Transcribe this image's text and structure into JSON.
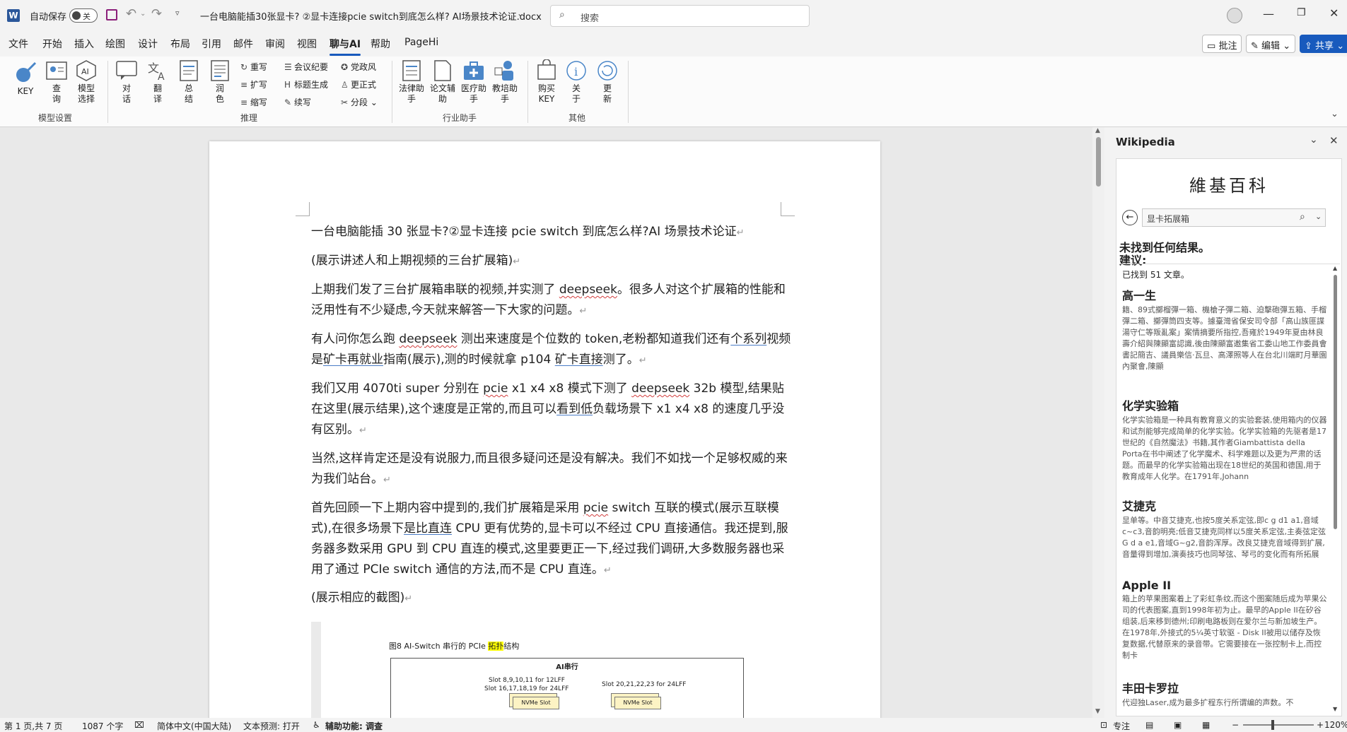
{
  "titlebar": {
    "autosave_label": "自动保存",
    "autosave_state": "关",
    "doc_title": "一台电脑能插30张显卡? ②显卡连接pcie switch到底怎么样? AI场景技术论证.docx",
    "search_placeholder": "搜索"
  },
  "menu": {
    "items": [
      "文件",
      "开始",
      "插入",
      "绘图",
      "设计",
      "布局",
      "引用",
      "邮件",
      "审阅",
      "视图",
      "聊与AI",
      "帮助",
      "PageHi"
    ],
    "active": "聊与AI",
    "comment_btn": "批注",
    "edit_btn": "编辑",
    "share_btn": "共享"
  },
  "ribbon": {
    "model_group": {
      "label": "模型设置",
      "key": "KEY",
      "query": "查询",
      "model": "模型选择"
    },
    "infer_group": {
      "label": "推理",
      "dialog": "对话",
      "translate": "翻译",
      "summary": "总结",
      "polish": "润色",
      "rewrite": "重写",
      "expand": "扩写",
      "shorten": "缩写",
      "minutes": "会议纪要",
      "title_gen": "标题生成",
      "continue": "续写",
      "party": "党政风",
      "formal": "更正式",
      "split": "分段"
    },
    "industry_group": {
      "label": "行业助手",
      "law": "法律助手",
      "paper": "论文辅助",
      "medical": "医疗助手",
      "teaching": "教培助手"
    },
    "other_group": {
      "label": "其他",
      "buy": "购买KEY",
      "about": "关于",
      "update": "更新"
    }
  },
  "document": {
    "p1": "一台电脑能插 30 张显卡?②显卡连接 pcie switch 到底怎么样?AI 场景技术论证",
    "p2": "(展示讲述人和上期视频的三台扩展箱)",
    "p3a": "上期我们发了三台扩展箱串联的视频,并实测了 ",
    "p3b": "deepseek",
    "p3c": "。很多人对这个扩展箱的性能和泛用性有不少疑虑,今天就来解答一下大家的问题。",
    "p4a": "有人问你怎么跑 ",
    "p4b": "deepseek",
    "p4c": " 测出来速度是个位数的 token,老粉都知道我们还有",
    "p4d": "个系列",
    "p4e": "视频是",
    "p4f": "矿卡再就业",
    "p4g": "指南(展示),测的时候就拿 p104 ",
    "p4h": "矿卡直接",
    "p4i": "测了。",
    "p5a": "我们又用 4070ti super 分别在 ",
    "p5b": "pcie",
    "p5c": " x1 x4 x8 模式下测了 ",
    "p5d": "deepseek",
    "p5e": " 32b 模型,结果贴在这里(展示结果),这个速度是正常的,而且可以",
    "p5f": "看到低",
    "p5g": "负载场景下 x1 x4 x8 的速度几乎没有区别。",
    "p6": "当然,这样肯定还是没有说服力,而且很多疑问还是没有解决。我们不如找一个足够权威的来为我们站台。",
    "p7a": "首先回顾一下上期内容中提到的,我们扩展箱是采用 ",
    "p7b": "pcie",
    "p7c": " switch 互联的模式(展示互联模式),在很多场景下",
    "p7d": "是比直连",
    "p7e": " CPU 更有优势的,显卡可以不经过 CPU 直接通信。我还提到,服务器多数采用 GPU 到 CPU 直连的模式,这里要更正一下,经过我们调研,大多数服务器也采用了通过 PCIe switch 通信的方法,而不是 CPU 直连。",
    "p8": "(展示相应的截图)",
    "figure": {
      "caption_a": "图8 AI-Switch 串行的 PCIe ",
      "caption_b": "拓扑",
      "caption_c": "结构",
      "box_title": "AI串行",
      "slot_left_1": "Slot 8,9,10,11 for 12LFF",
      "slot_left_2": "Slot 16,17,18,19 for 24LFF",
      "slot_right": "Slot 20,21,22,23 for 24LFF",
      "nvme": "NVMe Slot"
    }
  },
  "wikipedia": {
    "pane_title": "Wikipedia",
    "logo": "維基百科",
    "query": "显卡拓展箱",
    "no_result": "未找到任何结果。",
    "suggest": "建议:",
    "found": "已找到 51 文章。",
    "entries": [
      {
        "title": "高一生",
        "desc": "籍、89式擲榴彈一箱、機槍子彈二箱、迫擊砲彈五箱、手榴彈二箱、擲彈筒四支等。據臺灣省保安司令部「高山族匪諜湯守仁等叛亂案」案情摘要所指控,吾雍於1949年夏由林良壽介紹與陳顯富認識,後由陳顯富邀集省工委山地工作委員會書記簡吉、議員樂信·瓦旦、高澤照等人在台北川端町月華園內聚會,陳顯"
      },
      {
        "title": "化学实验箱",
        "desc": "化学实验箱是一种具有教育意义的实验套装,使用箱内的仪器和试剂能够完成简单的化学实验。化学实验箱的先驱者是17世纪的《自然魔法》书籍,其作者Giambattista della Porta在书中阐述了化学魔术、科学难题以及更为严肃的话题。而最早的化学实验箱出现在18世纪的英国和德国,用于教育成年人化学。在1791年,Johann"
      },
      {
        "title": "艾捷克",
        "desc": "显单等。中音艾捷克,也按5度关系定弦,即c g d1 a1,音域c~c3,音韵明亮;低音艾捷克同样以5度关系定弦,主奏弦定弦G d a e1,音域G~g2,音韵浑厚。改良艾捷克音域得到扩展,音量得到增加,演奏技巧也同琴弦、琴弓的变化而有所拓展"
      },
      {
        "title": "Apple II",
        "desc": "箱上的苹果图案着上了彩虹条纹,而这个图案随后成为苹果公司的代表图案,直到1998年初为止。最早的Apple II在矽谷组装,后来移到德州;印刷电路板则在爱尔兰与新加坡生产。在1978年,外接式的5¼英寸软驱 - Disk II被用以储存及恢复数据,代替原来的录音带。它需要接在一张控制卡上,而控制卡"
      },
      {
        "title": "丰田卡罗拉",
        "desc": "代迎独Laser,成为最多扩程东行所谓编的声数。不"
      }
    ]
  },
  "status": {
    "page": "第 1 页,共 7 页",
    "words": "1087 个字",
    "lang": "简体中文(中国大陆)",
    "predict": "文本预测: 打开",
    "access": "辅助功能: 调查",
    "focus": "专注",
    "zoom": "120%"
  },
  "colors": {
    "accent": "#185abd",
    "word_blue": "#2b579a",
    "highlight": "#ffff00"
  }
}
